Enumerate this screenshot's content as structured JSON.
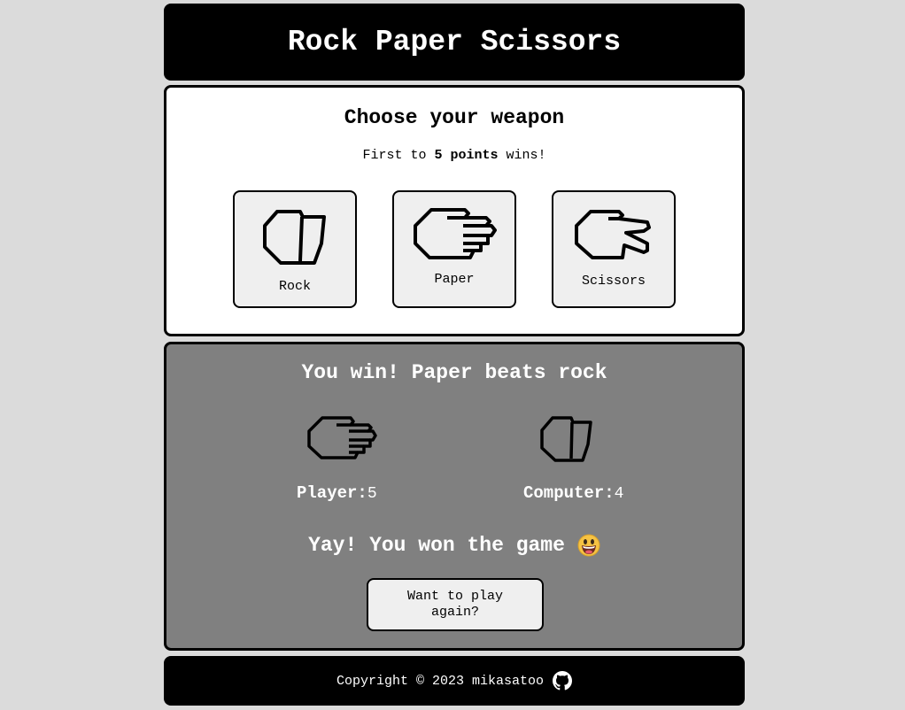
{
  "header": {
    "title": "Rock Paper Scissors"
  },
  "choose": {
    "title": "Choose your weapon",
    "subtitle_prefix": "First to ",
    "subtitle_bold": "5 points",
    "subtitle_suffix": " wins!",
    "weapons": [
      {
        "label": "Rock",
        "icon": "rock-icon"
      },
      {
        "label": "Paper",
        "icon": "paper-icon"
      },
      {
        "label": "Scissors",
        "icon": "scissors-icon"
      }
    ]
  },
  "result": {
    "message": "You win! Paper beats rock",
    "player_hand": "paper-icon",
    "computer_hand": "rock-icon",
    "player_label": "Player:",
    "player_score": "5",
    "computer_label": "Computer:",
    "computer_score": "4",
    "game_over": "Yay! You won the game",
    "game_over_emoji": "grinning-face-icon",
    "replay_label": "Want to play again?"
  },
  "footer": {
    "copyright": "Copyright © 2023 mikasatoo",
    "icon": "github-icon"
  }
}
